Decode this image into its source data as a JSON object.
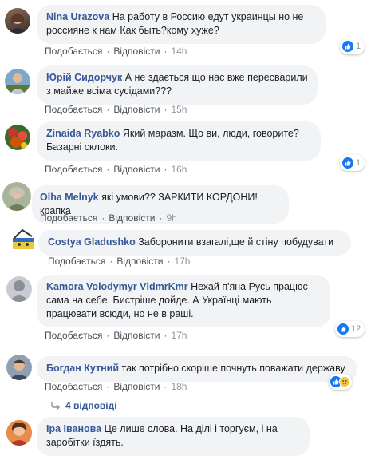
{
  "actions": {
    "like": "Подобається",
    "reply": "Відповісти",
    "dot": "·"
  },
  "comments": [
    {
      "name": "Nina Urazova",
      "text": "На работу в Россию едут украинцы но не россияне к нам Как быть?кому хуже?",
      "time": "14h",
      "reactions": "1"
    },
    {
      "name": "Юрій Сидорчук",
      "text": "А не здається що нас вже пересварили з майже всіма сусідами???",
      "time": "15h"
    },
    {
      "name": "Zinaida Ryabko",
      "text": "Який маразм. Що ви, люди, говорите? Базарні склоки.",
      "time": "16h",
      "reactions": "1"
    },
    {
      "name": "Olha Melnyk",
      "text": "які умови?? ЗАРКИТИ КОРДОНИ! крапка",
      "time": "9h"
    },
    {
      "name": "Costya Gladushko",
      "text": "Заборонити взагалі,ще й стіну побудувати",
      "time": "17h"
    },
    {
      "name": "Kamora Volodymyr VldmrKmr",
      "text": "Нехай п'яна Русь працює сама на себе. Бистріше дойде. А Українці мають працювати всюди, но не в раші.",
      "time": "17h",
      "reactions": "12"
    },
    {
      "name": "Богдан Кутний",
      "text": "так потрібно скоріше почнуть поважати державу",
      "time": "18h"
    },
    {
      "name": "Іра Іванова",
      "text": "Це лише слова. На ділі і торгуєм, і на заробітки їздять."
    }
  ],
  "replies_link": "4 відповіді",
  "colors": {
    "link": "#385898",
    "like": "#1877f2",
    "bubble": "#f2f3f5"
  }
}
